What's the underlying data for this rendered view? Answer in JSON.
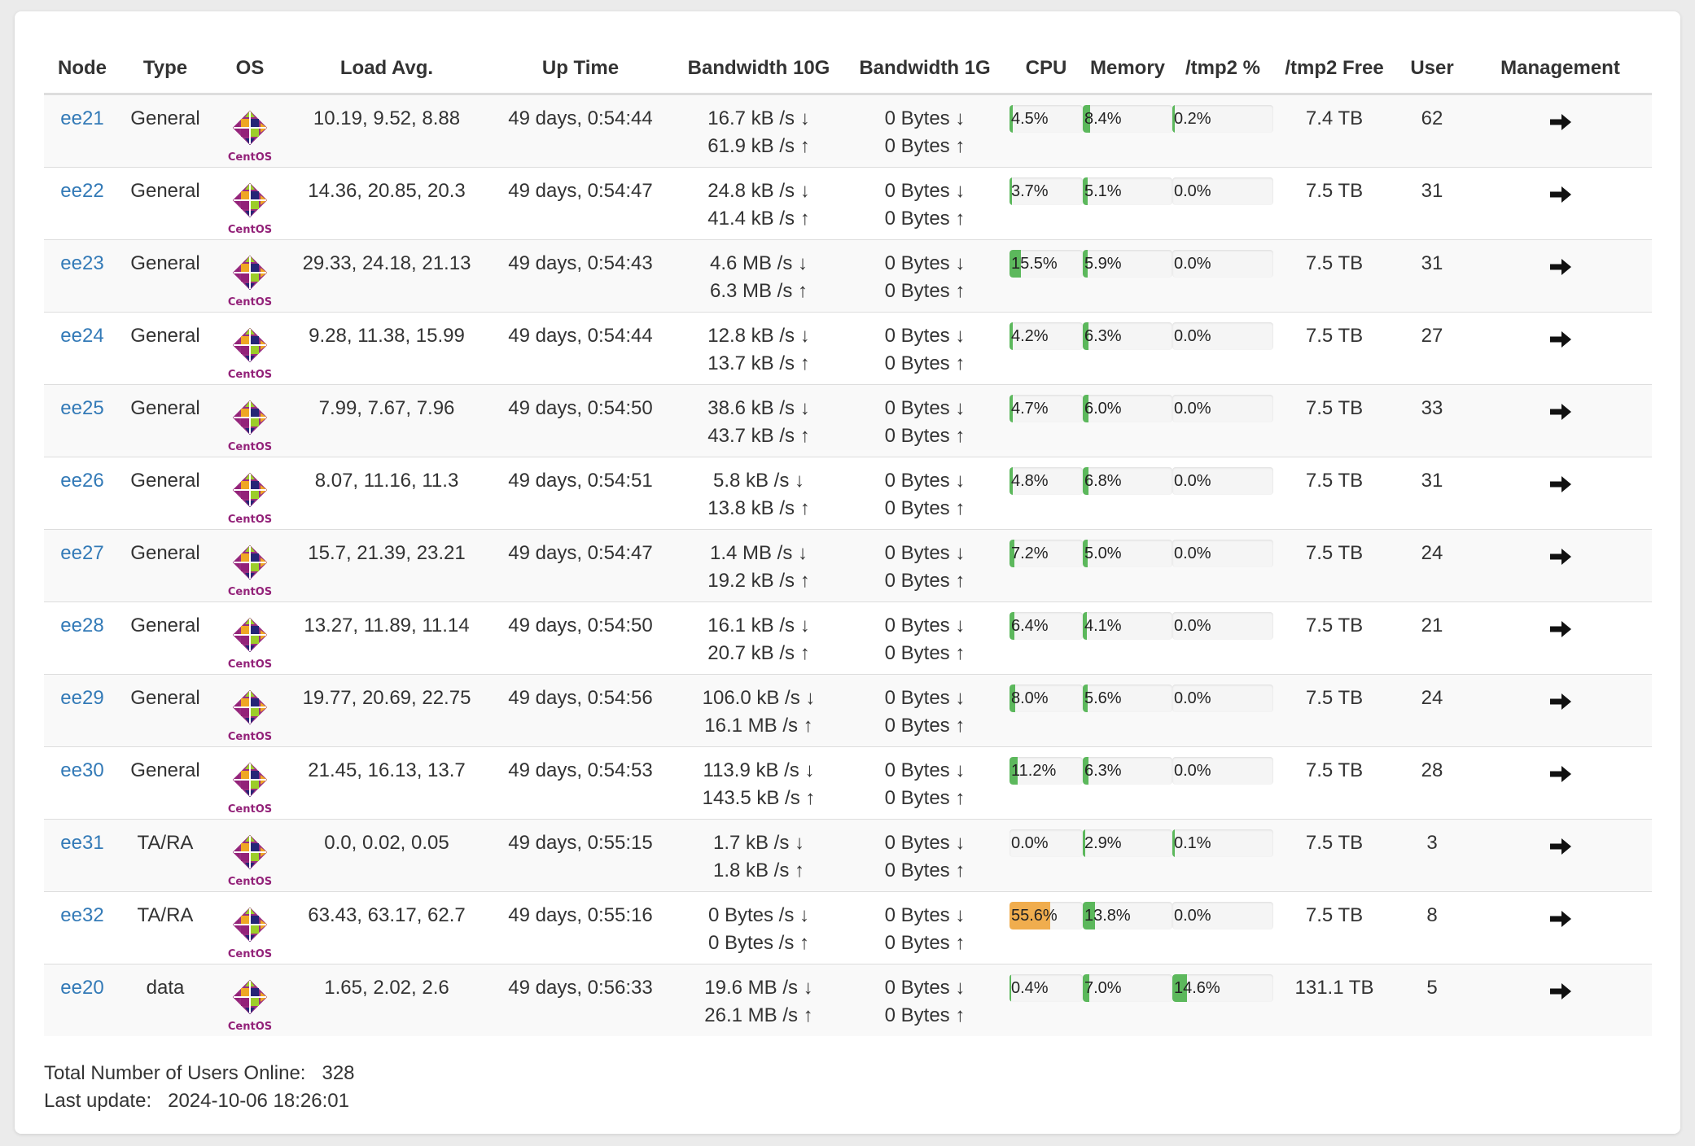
{
  "table": {
    "headers": [
      "Node",
      "Type",
      "OS",
      "Load Avg.",
      "Up Time",
      "Bandwidth 10G",
      "Bandwidth 1G",
      "CPU",
      "Memory",
      "/tmp2 %",
      "/tmp2 Free",
      "User",
      "Management"
    ],
    "os_icon": "centos-logo-icon",
    "management_icon": "arrow-right-icon",
    "rows": [
      {
        "node": "ee21",
        "type": "General",
        "load": "10.19, 9.52, 8.88",
        "uptime": "49 days, 0:54:44",
        "bw10_down": "16.7 kB /s ↓",
        "bw10_up": "61.9 kB /s ↑",
        "bw1_down": "0 Bytes ↓",
        "bw1_up": "0 Bytes ↑",
        "cpu": 4.5,
        "cpu_text": "4.5%",
        "mem": 8.4,
        "mem_text": "8.4%",
        "tmp": 0.2,
        "tmp_text": "0.2%",
        "free": "7.4 TB",
        "users": "62"
      },
      {
        "node": "ee22",
        "type": "General",
        "load": "14.36, 20.85, 20.3",
        "uptime": "49 days, 0:54:47",
        "bw10_down": "24.8 kB /s ↓",
        "bw10_up": "41.4 kB /s ↑",
        "bw1_down": "0 Bytes ↓",
        "bw1_up": "0 Bytes ↑",
        "cpu": 3.7,
        "cpu_text": "3.7%",
        "mem": 5.1,
        "mem_text": "5.1%",
        "tmp": 0.0,
        "tmp_text": "0.0%",
        "free": "7.5 TB",
        "users": "31"
      },
      {
        "node": "ee23",
        "type": "General",
        "load": "29.33, 24.18, 21.13",
        "uptime": "49 days, 0:54:43",
        "bw10_down": "4.6 MB /s ↓",
        "bw10_up": "6.3 MB /s ↑",
        "bw1_down": "0 Bytes ↓",
        "bw1_up": "0 Bytes ↑",
        "cpu": 15.5,
        "cpu_text": "15.5%",
        "mem": 5.9,
        "mem_text": "5.9%",
        "tmp": 0.0,
        "tmp_text": "0.0%",
        "free": "7.5 TB",
        "users": "31"
      },
      {
        "node": "ee24",
        "type": "General",
        "load": "9.28, 11.38, 15.99",
        "uptime": "49 days, 0:54:44",
        "bw10_down": "12.8 kB /s ↓",
        "bw10_up": "13.7 kB /s ↑",
        "bw1_down": "0 Bytes ↓",
        "bw1_up": "0 Bytes ↑",
        "cpu": 4.2,
        "cpu_text": "4.2%",
        "mem": 6.3,
        "mem_text": "6.3%",
        "tmp": 0.0,
        "tmp_text": "0.0%",
        "free": "7.5 TB",
        "users": "27"
      },
      {
        "node": "ee25",
        "type": "General",
        "load": "7.99, 7.67, 7.96",
        "uptime": "49 days, 0:54:50",
        "bw10_down": "38.6 kB /s ↓",
        "bw10_up": "43.7 kB /s ↑",
        "bw1_down": "0 Bytes ↓",
        "bw1_up": "0 Bytes ↑",
        "cpu": 4.7,
        "cpu_text": "4.7%",
        "mem": 6.0,
        "mem_text": "6.0%",
        "tmp": 0.0,
        "tmp_text": "0.0%",
        "free": "7.5 TB",
        "users": "33"
      },
      {
        "node": "ee26",
        "type": "General",
        "load": "8.07, 11.16, 11.3",
        "uptime": "49 days, 0:54:51",
        "bw10_down": "5.8 kB /s ↓",
        "bw10_up": "13.8 kB /s ↑",
        "bw1_down": "0 Bytes ↓",
        "bw1_up": "0 Bytes ↑",
        "cpu": 4.8,
        "cpu_text": "4.8%",
        "mem": 6.8,
        "mem_text": "6.8%",
        "tmp": 0.0,
        "tmp_text": "0.0%",
        "free": "7.5 TB",
        "users": "31"
      },
      {
        "node": "ee27",
        "type": "General",
        "load": "15.7, 21.39, 23.21",
        "uptime": "49 days, 0:54:47",
        "bw10_down": "1.4 MB /s ↓",
        "bw10_up": "19.2 kB /s ↑",
        "bw1_down": "0 Bytes ↓",
        "bw1_up": "0 Bytes ↑",
        "cpu": 7.2,
        "cpu_text": "7.2%",
        "mem": 5.0,
        "mem_text": "5.0%",
        "tmp": 0.0,
        "tmp_text": "0.0%",
        "free": "7.5 TB",
        "users": "24"
      },
      {
        "node": "ee28",
        "type": "General",
        "load": "13.27, 11.89, 11.14",
        "uptime": "49 days, 0:54:50",
        "bw10_down": "16.1 kB /s ↓",
        "bw10_up": "20.7 kB /s ↑",
        "bw1_down": "0 Bytes ↓",
        "bw1_up": "0 Bytes ↑",
        "cpu": 6.4,
        "cpu_text": "6.4%",
        "mem": 4.1,
        "mem_text": "4.1%",
        "tmp": 0.0,
        "tmp_text": "0.0%",
        "free": "7.5 TB",
        "users": "21"
      },
      {
        "node": "ee29",
        "type": "General",
        "load": "19.77, 20.69, 22.75",
        "uptime": "49 days, 0:54:56",
        "bw10_down": "106.0 kB /s ↓",
        "bw10_up": "16.1 MB /s ↑",
        "bw1_down": "0 Bytes ↓",
        "bw1_up": "0 Bytes ↑",
        "cpu": 8.0,
        "cpu_text": "8.0%",
        "mem": 5.6,
        "mem_text": "5.6%",
        "tmp": 0.0,
        "tmp_text": "0.0%",
        "free": "7.5 TB",
        "users": "24"
      },
      {
        "node": "ee30",
        "type": "General",
        "load": "21.45, 16.13, 13.7",
        "uptime": "49 days, 0:54:53",
        "bw10_down": "113.9 kB /s ↓",
        "bw10_up": "143.5 kB /s ↑",
        "bw1_down": "0 Bytes ↓",
        "bw1_up": "0 Bytes ↑",
        "cpu": 11.2,
        "cpu_text": "11.2%",
        "mem": 6.3,
        "mem_text": "6.3%",
        "tmp": 0.0,
        "tmp_text": "0.0%",
        "free": "7.5 TB",
        "users": "28"
      },
      {
        "node": "ee31",
        "type": "TA/RA",
        "load": "0.0, 0.02, 0.05",
        "uptime": "49 days, 0:55:15",
        "bw10_down": "1.7 kB /s ↓",
        "bw10_up": "1.8 kB /s ↑",
        "bw1_down": "0 Bytes ↓",
        "bw1_up": "0 Bytes ↑",
        "cpu": 0.0,
        "cpu_text": "0.0%",
        "mem": 2.9,
        "mem_text": "2.9%",
        "tmp": 0.1,
        "tmp_text": "0.1%",
        "free": "7.5 TB",
        "users": "3"
      },
      {
        "node": "ee32",
        "type": "TA/RA",
        "load": "63.43, 63.17, 62.7",
        "uptime": "49 days, 0:55:16",
        "bw10_down": "0 Bytes /s ↓",
        "bw10_up": "0 Bytes /s ↑",
        "bw1_down": "0 Bytes ↓",
        "bw1_up": "0 Bytes ↑",
        "cpu": 55.6,
        "cpu_text": "55.6%",
        "mem": 13.8,
        "mem_text": "13.8%",
        "tmp": 0.0,
        "tmp_text": "0.0%",
        "free": "7.5 TB",
        "users": "8"
      },
      {
        "node": "ee20",
        "type": "data",
        "load": "1.65, 2.02, 2.6",
        "uptime": "49 days, 0:56:33",
        "bw10_down": "19.6 MB /s ↓",
        "bw10_up": "26.1 MB /s ↑",
        "bw1_down": "0 Bytes ↓",
        "bw1_up": "0 Bytes ↑",
        "cpu": 0.4,
        "cpu_text": "0.4%",
        "mem": 7.0,
        "mem_text": "7.0%",
        "tmp": 14.6,
        "tmp_text": "14.6%",
        "free": "131.1 TB",
        "users": "5"
      }
    ]
  },
  "colors": {
    "bar_normal": "#5cb85c",
    "bar_warning": "#f0ad4e",
    "link": "#337ab7"
  },
  "footer": {
    "total_label": "Total Number of Users Online:",
    "total_value": "328",
    "update_label": "Last update:",
    "update_value": "2024-10-06 18:26:01"
  }
}
